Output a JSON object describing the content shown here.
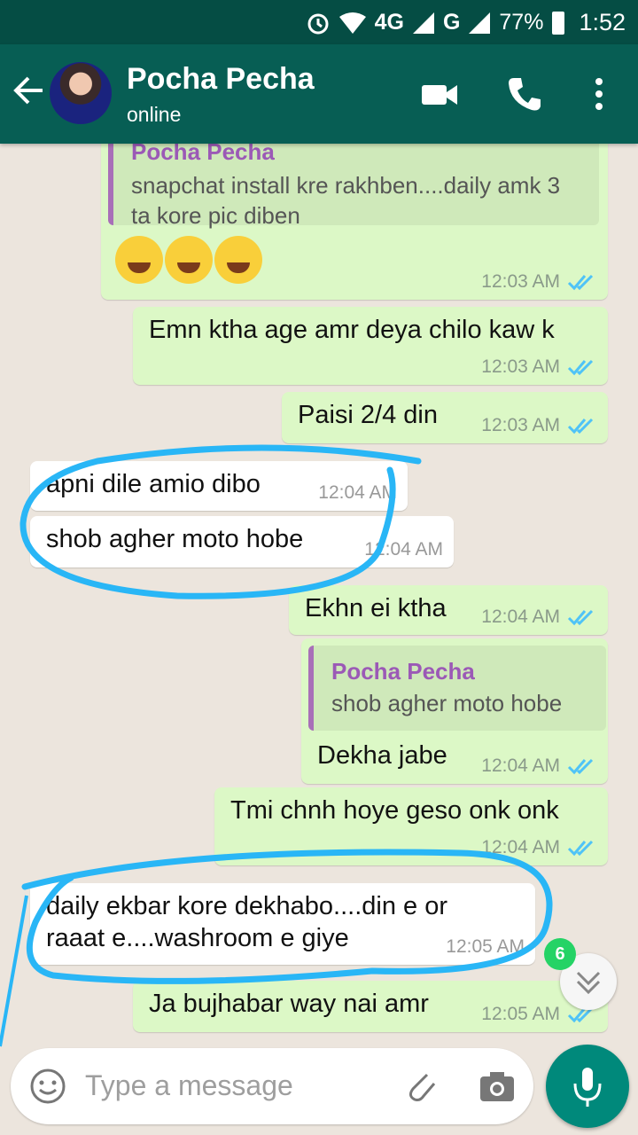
{
  "status_bar": {
    "network": "4G",
    "carrier": "G",
    "battery": "77%",
    "time": "1:52"
  },
  "header": {
    "title": "Pocha Pecha",
    "subtitle": "online"
  },
  "messages": [
    {
      "quote_author": "Pocha Pecha",
      "quote_text_1": "snapchat install kre rakhben....daily amk 3",
      "quote_text_2": "ta kore pic diben",
      "time": "12:03 AM"
    },
    {
      "text": "Emn ktha age amr deya chilo kaw k",
      "time": "12:03 AM"
    },
    {
      "text": "Paisi 2/4 din",
      "time": "12:03 AM"
    },
    {
      "text": "apni dile amio dibo",
      "time": "12:04 AM"
    },
    {
      "text": "shob agher moto hobe",
      "time": "12:04 AM"
    },
    {
      "text": "Ekhn ei ktha",
      "time": "12:04 AM"
    },
    {
      "quote_author": "Pocha Pecha",
      "quote_text": "shob agher moto hobe",
      "text": "Dekha jabe",
      "time": "12:04 AM"
    },
    {
      "text": "Tmi chnh hoye geso onk onk",
      "time": "12:04 AM"
    },
    {
      "text_1": "daily ekbar kore dekhabo....din e or",
      "text_2": "raaat e....washroom e giye",
      "time": "12:05 AM"
    },
    {
      "text": "Ja bujhabar way nai amr",
      "time": "12:05 AM"
    }
  ],
  "unread_badge": "6",
  "input": {
    "placeholder": "Type a message"
  },
  "colors": {
    "header": "#075e54",
    "outgoing": "#dcf8c6",
    "incoming": "#ffffff",
    "tick": "#4fc3f7",
    "annotation": "#29b6f6"
  }
}
